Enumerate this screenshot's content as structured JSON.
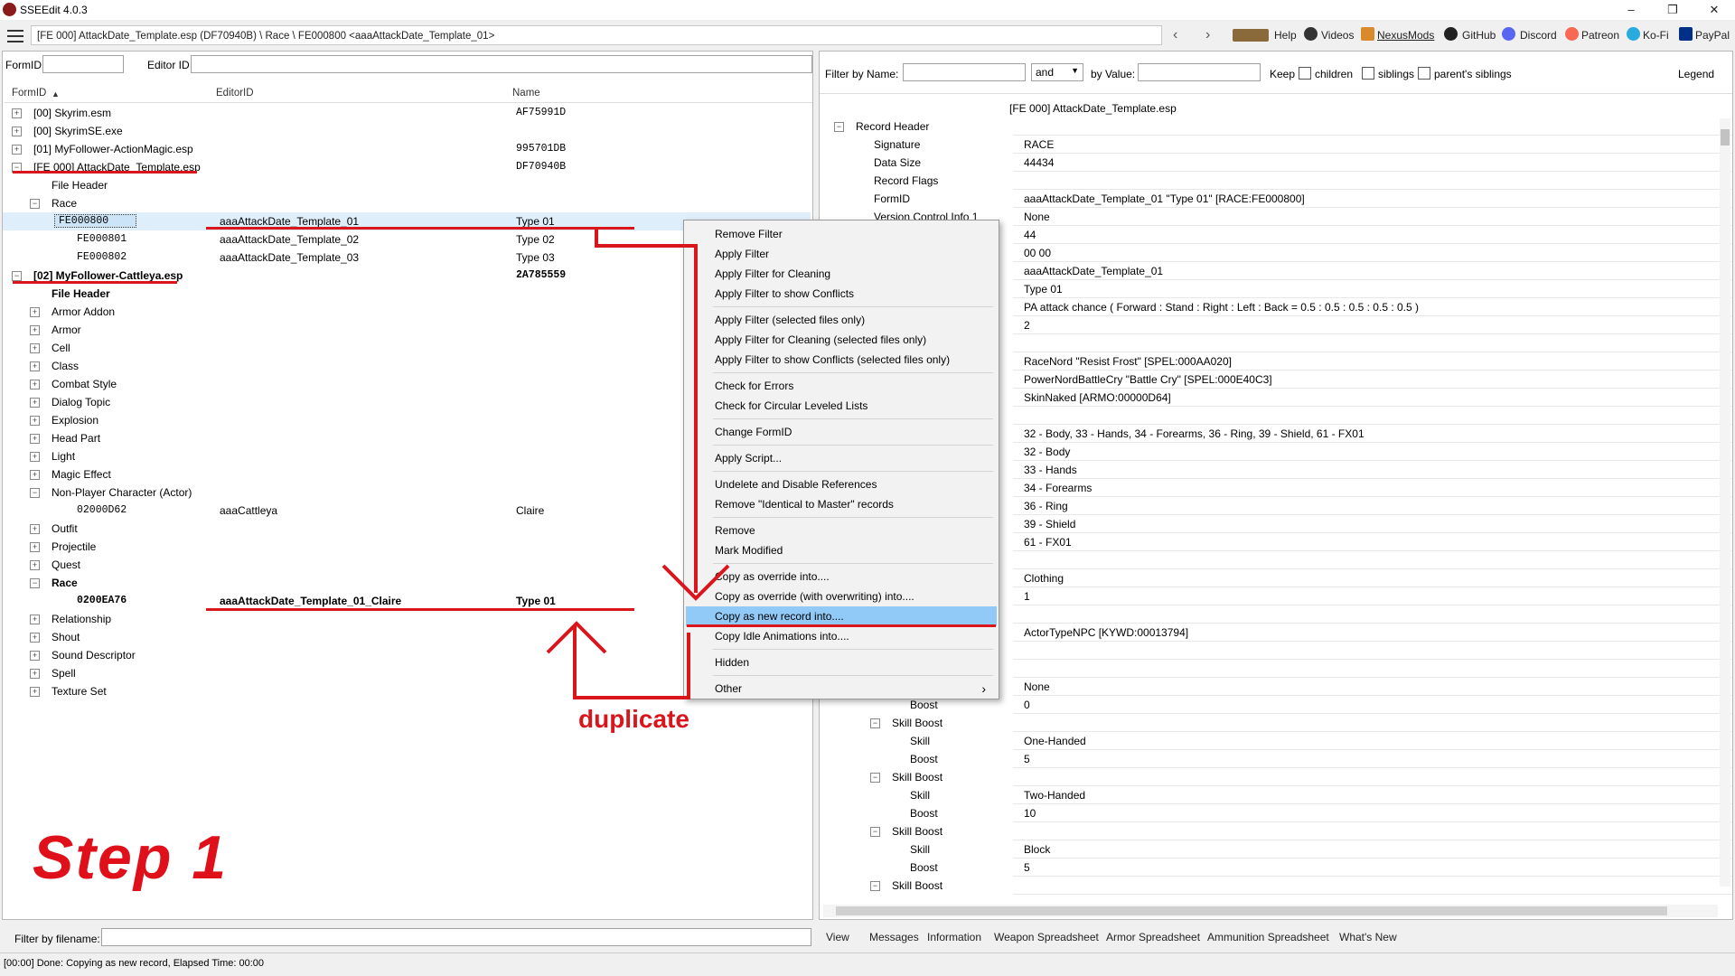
{
  "window": {
    "title": "SSEEdit 4.0.3"
  },
  "toolbar": {
    "path": "[FE 000] AttackDate_Template.esp (DF70940B) \\ Race \\ FE000800 <aaaAttackDate_Template_01>",
    "links": [
      "Help",
      "Videos",
      "NexusMods",
      "GitHub",
      "Discord",
      "Patreon",
      "Ko-Fi",
      "PayPal"
    ]
  },
  "left": {
    "formid_label": "FormID",
    "editorid_label": "Editor ID",
    "columns": [
      "FormID",
      "EditorID",
      "Name"
    ],
    "filter_label": "Filter by filename:"
  },
  "tree": [
    {
      "indent": 0,
      "exp": "+",
      "c1": "[00] Skyrim.esm",
      "c2": "",
      "c3": "AF75991D",
      "c3mono": true
    },
    {
      "indent": 0,
      "exp": "+",
      "c1": "[00] SkyrimSE.exe",
      "c2": "",
      "c3": ""
    },
    {
      "indent": 0,
      "exp": "+",
      "c1": "[01] MyFollower-ActionMagic.esp",
      "c2": "",
      "c3": "995701DB",
      "c3mono": true
    },
    {
      "indent": 0,
      "exp": "-",
      "c1": "[FE 000] AttackDate_Template.esp",
      "c2": "",
      "c3": "DF70940B",
      "c3mono": true
    },
    {
      "indent": 1,
      "exp": "",
      "c1": "File Header",
      "c2": "",
      "c3": ""
    },
    {
      "indent": 1,
      "exp": "-",
      "c1": "Race",
      "c2": "",
      "c3": ""
    },
    {
      "indent": 2,
      "exp": "",
      "c1": "FE000800",
      "c2": "aaaAttackDate_Template_01",
      "c3": "Type 01",
      "mono": true,
      "sel": true
    },
    {
      "indent": 2,
      "exp": "",
      "c1": "FE000801",
      "c2": "aaaAttackDate_Template_02",
      "c3": "Type 02",
      "mono": true
    },
    {
      "indent": 2,
      "exp": "",
      "c1": "FE000802",
      "c2": "aaaAttackDate_Template_03",
      "c3": "Type 03",
      "mono": true
    },
    {
      "indent": 0,
      "exp": "-",
      "c1": "[02] MyFollower-Cattleya.esp",
      "c2": "",
      "c3": "2A785559",
      "c3mono": true,
      "bold": true
    },
    {
      "indent": 1,
      "exp": "",
      "c1": "File Header",
      "c2": "",
      "c3": "",
      "bold": true
    },
    {
      "indent": 1,
      "exp": "+",
      "c1": "Armor Addon",
      "c2": "",
      "c3": ""
    },
    {
      "indent": 1,
      "exp": "+",
      "c1": "Armor",
      "c2": "",
      "c3": ""
    },
    {
      "indent": 1,
      "exp": "+",
      "c1": "Cell",
      "c2": "",
      "c3": ""
    },
    {
      "indent": 1,
      "exp": "+",
      "c1": "Class",
      "c2": "",
      "c3": ""
    },
    {
      "indent": 1,
      "exp": "+",
      "c1": "Combat Style",
      "c2": "",
      "c3": ""
    },
    {
      "indent": 1,
      "exp": "+",
      "c1": "Dialog Topic",
      "c2": "",
      "c3": ""
    },
    {
      "indent": 1,
      "exp": "+",
      "c1": "Explosion",
      "c2": "",
      "c3": ""
    },
    {
      "indent": 1,
      "exp": "+",
      "c1": "Head Part",
      "c2": "",
      "c3": ""
    },
    {
      "indent": 1,
      "exp": "+",
      "c1": "Light",
      "c2": "",
      "c3": ""
    },
    {
      "indent": 1,
      "exp": "+",
      "c1": "Magic Effect",
      "c2": "",
      "c3": ""
    },
    {
      "indent": 1,
      "exp": "-",
      "c1": "Non-Player Character (Actor)",
      "c2": "",
      "c3": ""
    },
    {
      "indent": 2,
      "exp": "",
      "c1": "02000D62",
      "c2": "aaaCattleya",
      "c3": "Claire",
      "mono": true
    },
    {
      "indent": 1,
      "exp": "+",
      "c1": "Outfit",
      "c2": "",
      "c3": ""
    },
    {
      "indent": 1,
      "exp": "+",
      "c1": "Projectile",
      "c2": "",
      "c3": ""
    },
    {
      "indent": 1,
      "exp": "+",
      "c1": "Quest",
      "c2": "",
      "c3": ""
    },
    {
      "indent": 1,
      "exp": "-",
      "c1": "Race",
      "c2": "",
      "c3": "",
      "bold": true
    },
    {
      "indent": 2,
      "exp": "",
      "c1": "0200EA76",
      "c2": "aaaAttackDate_Template_01_Claire",
      "c3": "Type 01",
      "mono": true,
      "bold": true
    },
    {
      "indent": 1,
      "exp": "+",
      "c1": "Relationship",
      "c2": "",
      "c3": ""
    },
    {
      "indent": 1,
      "exp": "+",
      "c1": "Shout",
      "c2": "",
      "c3": ""
    },
    {
      "indent": 1,
      "exp": "+",
      "c1": "Sound Descriptor",
      "c2": "",
      "c3": ""
    },
    {
      "indent": 1,
      "exp": "+",
      "c1": "Spell",
      "c2": "",
      "c3": ""
    },
    {
      "indent": 1,
      "exp": "+",
      "c1": "Texture Set",
      "c2": "",
      "c3": ""
    }
  ],
  "right": {
    "filter_name_label": "Filter by Name:",
    "and_value": "and",
    "by_value_label": "by Value:",
    "keep_label": "Keep",
    "children_label": "children",
    "siblings_label": "siblings",
    "parents_siblings_label": "parent's siblings",
    "legend_label": "Legend",
    "file_header": "[FE 000] AttackDate_Template.esp"
  },
  "record": [
    {
      "indent": 0,
      "exp": "-",
      "k": "Record Header",
      "v": ""
    },
    {
      "indent": 1,
      "exp": "",
      "k": "Signature",
      "v": "RACE"
    },
    {
      "indent": 1,
      "exp": "",
      "k": "Data Size",
      "v": "44434"
    },
    {
      "indent": 1,
      "exp": "",
      "k": "Record Flags",
      "v": ""
    },
    {
      "indent": 1,
      "exp": "",
      "k": "FormID",
      "v": "aaaAttackDate_Template_01 \"Type 01\" [RACE:FE000800]"
    },
    {
      "indent": 1,
      "exp": "",
      "k": "Version Control Info 1",
      "v": "None"
    },
    {
      "indent": 1,
      "exp": "",
      "k": "",
      "v": "44"
    },
    {
      "indent": 1,
      "exp": "",
      "k": "",
      "v": "00 00"
    },
    {
      "indent": 0,
      "exp": "",
      "k": "",
      "v": "aaaAttackDate_Template_01"
    },
    {
      "indent": 0,
      "exp": "",
      "k": "",
      "v": "Type 01"
    },
    {
      "indent": 0,
      "exp": "",
      "k": "",
      "v": "PA attack chance ( Forward : Stand : Right : Left : Back = 0.5 : 0.5 : 0.5 : 0.5 : 0.5 )"
    },
    {
      "indent": 0,
      "exp": "",
      "k": "",
      "v": "2"
    },
    {
      "indent": 0,
      "exp": "",
      "k": "",
      "v": ""
    },
    {
      "indent": 0,
      "exp": "",
      "k": "",
      "v": "RaceNord \"Resist Frost\" [SPEL:000AA020]"
    },
    {
      "indent": 0,
      "exp": "",
      "k": "",
      "v": "PowerNordBattleCry \"Battle Cry\" [SPEL:000E40C3]"
    },
    {
      "indent": 0,
      "exp": "",
      "k": "",
      "v": "SkinNaked [ARMO:00000D64]"
    },
    {
      "indent": 0,
      "exp": "",
      "k": "",
      "v": ""
    },
    {
      "indent": 0,
      "exp": "",
      "k": "",
      "v": "32 - Body, 33 - Hands, 34 - Forearms, 36 - Ring, 39 - Shield, 61 - FX01"
    },
    {
      "indent": 0,
      "exp": "",
      "k": "",
      "v": "32 - Body"
    },
    {
      "indent": 0,
      "exp": "",
      "k": "",
      "v": "33 - Hands"
    },
    {
      "indent": 0,
      "exp": "",
      "k": "",
      "v": "34 - Forearms"
    },
    {
      "indent": 0,
      "exp": "",
      "k": "",
      "v": "36 - Ring"
    },
    {
      "indent": 0,
      "exp": "",
      "k": "",
      "v": "39 - Shield"
    },
    {
      "indent": 0,
      "exp": "",
      "k": "",
      "v": "61 - FX01"
    },
    {
      "indent": 0,
      "exp": "",
      "k": "",
      "v": ""
    },
    {
      "indent": 0,
      "exp": "",
      "k": "",
      "v": "Clothing"
    },
    {
      "indent": 0,
      "exp": "",
      "k": "",
      "v": "1"
    },
    {
      "indent": 0,
      "exp": "",
      "k": "",
      "v": ""
    },
    {
      "indent": 0,
      "exp": "",
      "k": "",
      "v": "ActorTypeNPC [KYWD:00013794]"
    },
    {
      "indent": 0,
      "exp": "",
      "k": "",
      "v": ""
    },
    {
      "indent": 0,
      "exp": "",
      "k": "",
      "v": ""
    },
    {
      "indent": 3,
      "exp": "",
      "k": "Skill",
      "v": "None"
    },
    {
      "indent": 3,
      "exp": "",
      "k": "Boost",
      "v": "0"
    },
    {
      "indent": 2,
      "exp": "-",
      "k": "Skill Boost",
      "v": ""
    },
    {
      "indent": 3,
      "exp": "",
      "k": "Skill",
      "v": "One-Handed"
    },
    {
      "indent": 3,
      "exp": "",
      "k": "Boost",
      "v": "5"
    },
    {
      "indent": 2,
      "exp": "-",
      "k": "Skill Boost",
      "v": ""
    },
    {
      "indent": 3,
      "exp": "",
      "k": "Skill",
      "v": "Two-Handed"
    },
    {
      "indent": 3,
      "exp": "",
      "k": "Boost",
      "v": "10"
    },
    {
      "indent": 2,
      "exp": "-",
      "k": "Skill Boost",
      "v": ""
    },
    {
      "indent": 3,
      "exp": "",
      "k": "Skill",
      "v": "Block"
    },
    {
      "indent": 3,
      "exp": "",
      "k": "Boost",
      "v": "5"
    },
    {
      "indent": 2,
      "exp": "-",
      "k": "Skill Boost",
      "v": ""
    }
  ],
  "context_menu": [
    {
      "label": "Remove Filter"
    },
    {
      "label": "Apply Filter"
    },
    {
      "label": "Apply Filter for Cleaning"
    },
    {
      "label": "Apply Filter to show Conflicts",
      "sep_after": true
    },
    {
      "label": "Apply Filter (selected files only)"
    },
    {
      "label": "Apply Filter for Cleaning (selected files only)"
    },
    {
      "label": "Apply Filter to show Conflicts (selected files only)",
      "sep_after": true
    },
    {
      "label": "Check for Errors"
    },
    {
      "label": "Check for Circular Leveled Lists",
      "sep_after": true
    },
    {
      "label": "Change FormID",
      "sep_after": true
    },
    {
      "label": "Apply Script...",
      "sep_after": true
    },
    {
      "label": "Undelete and Disable References"
    },
    {
      "label": "Remove \"Identical to Master\" records",
      "sep_after": true
    },
    {
      "label": "Remove"
    },
    {
      "label": "Mark Modified",
      "sep_after": true
    },
    {
      "label": "Copy as override into...."
    },
    {
      "label": "Copy as override (with overwriting) into...."
    },
    {
      "label": "Copy as new record into....",
      "highlight": true
    },
    {
      "label": "Copy Idle Animations into....",
      "sep_after": true
    },
    {
      "label": "Hidden",
      "sep_after": true
    },
    {
      "label": "Other",
      "submenu": true
    }
  ],
  "bottom_tabs": [
    "View",
    "Messages",
    "Information",
    "Weapon Spreadsheet",
    "Armor Spreadsheet",
    "Ammunition Spreadsheet",
    "What's New"
  ],
  "status": "[00:00] Done: Copying as new record, Elapsed Time: 00:00",
  "annotations": {
    "step": "Step  1",
    "duplicate": "duplicate"
  },
  "colors": {
    "annotation_red": "#d9161c",
    "selection": "#cce4f7",
    "menu_highlight": "#91c9f7"
  }
}
